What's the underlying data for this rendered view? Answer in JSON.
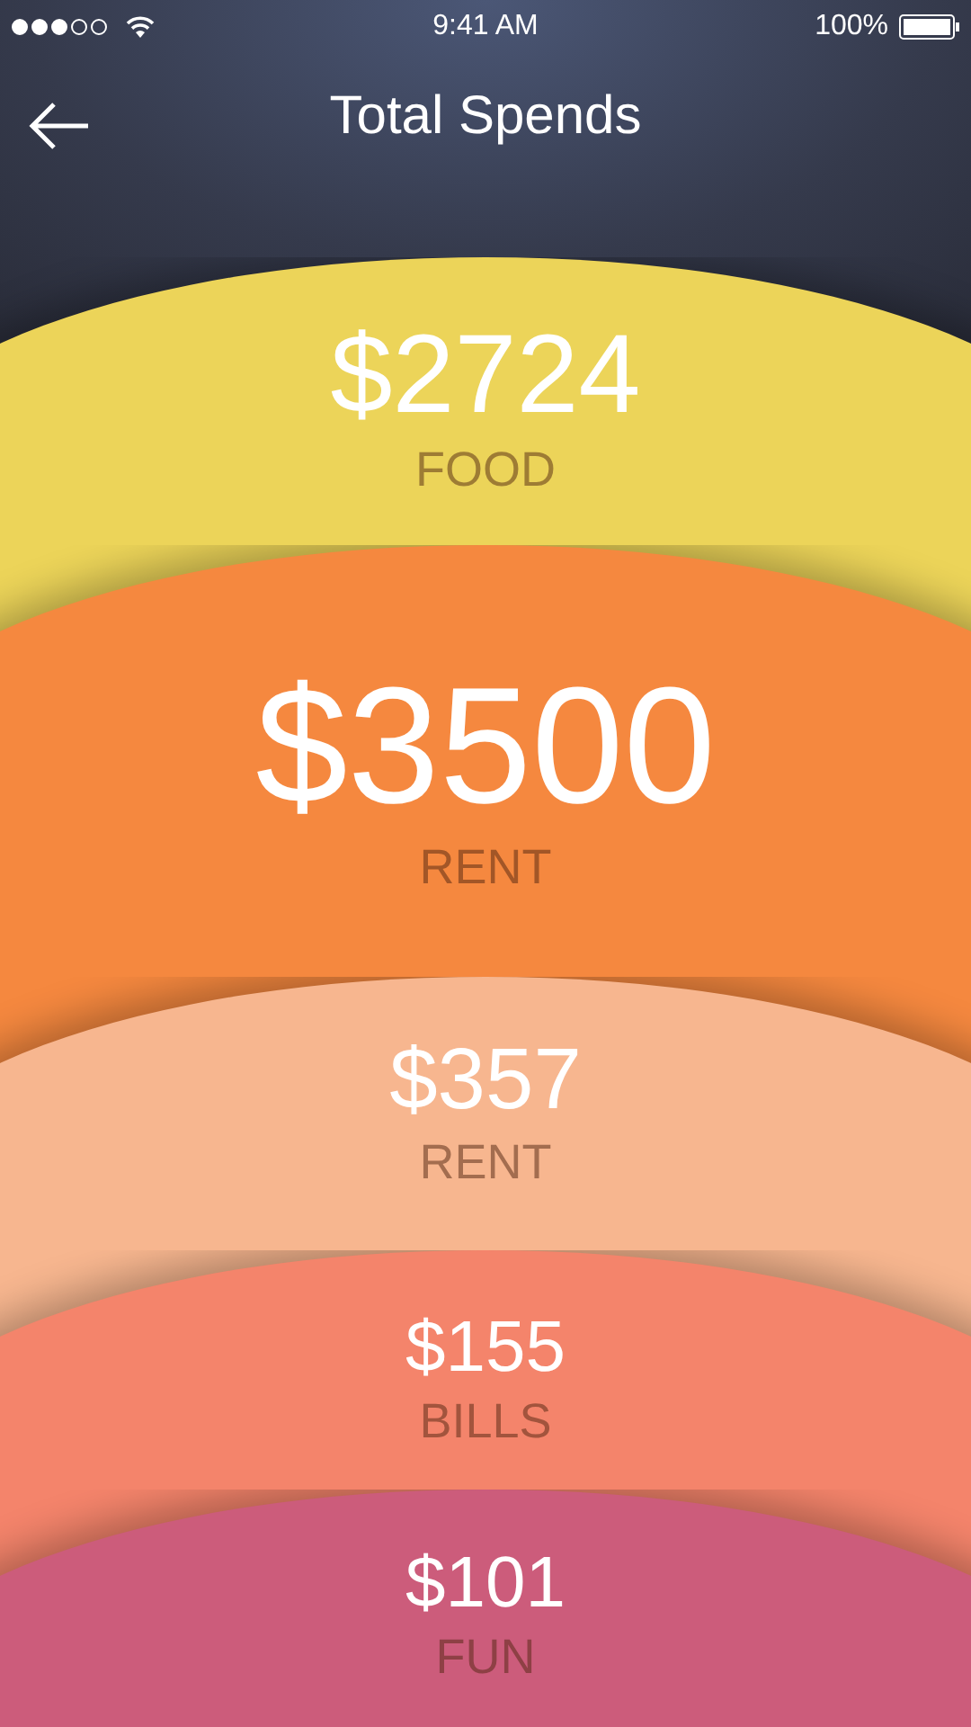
{
  "status_bar": {
    "time": "9:41 AM",
    "battery": "100%"
  },
  "header": {
    "title": "Total Spends"
  },
  "spends": [
    {
      "amount": "$2724",
      "category": "FOOD",
      "color": "#ecd459",
      "kind": "normal"
    },
    {
      "amount": "$3500",
      "category": "RENT",
      "color": "#f5883f",
      "kind": "large"
    },
    {
      "amount": "$357",
      "category": "RENT",
      "color": "#f7b68f",
      "kind": "normal"
    },
    {
      "amount": "$155",
      "category": "BILLS",
      "color": "#f4846b",
      "kind": "normal"
    },
    {
      "amount": "$101",
      "category": "FUN",
      "color": "#cc5c7b",
      "kind": "normal"
    }
  ]
}
